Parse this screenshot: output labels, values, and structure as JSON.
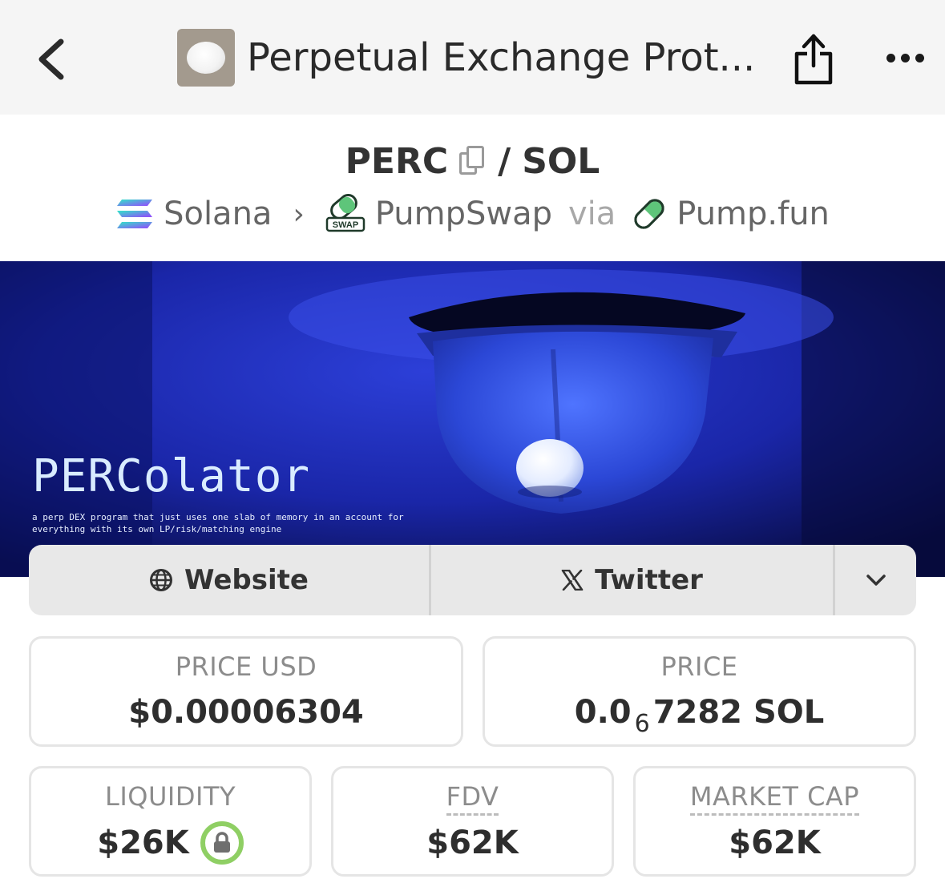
{
  "topbar": {
    "title": "Perpetual Exchange Prot..."
  },
  "pair": {
    "base": "PERC",
    "separator": "/",
    "quote": "SOL"
  },
  "breadcrumb": {
    "chain": "Solana",
    "dex": "PumpSwap",
    "dex_badge": "SWAP",
    "via_label": "via",
    "launchpad": "Pump.fun"
  },
  "banner": {
    "title": "PERColator",
    "subtitle": "a perp DEX program that just uses one slab of memory in an account for everything with its own LP/risk/matching engine"
  },
  "links": {
    "website_label": "Website",
    "twitter_label": "Twitter"
  },
  "stats": {
    "price_usd": {
      "label": "PRICE USD",
      "value": "$0.00006304"
    },
    "price": {
      "label": "PRICE",
      "value_prefix": "0.0",
      "value_zeros_count": "6",
      "value_suffix": "7282 SOL"
    },
    "liquidity": {
      "label": "LIQUIDITY",
      "value": "$26K"
    },
    "fdv": {
      "label": "FDV",
      "value": "$62K"
    },
    "market_cap": {
      "label": "MARKET CAP",
      "value": "$62K"
    }
  },
  "colors": {
    "topbar_bg": "#f5f5f5",
    "banner_bg": "#0e1570",
    "liquidity_lock_ring": "#8fcf64",
    "linkbar_bg": "#e8e8e8"
  },
  "icons": [
    "back-chevron-icon",
    "share-icon",
    "more-dots-icon",
    "copy-icon",
    "solana-icon",
    "pumpswap-icon",
    "pumpfun-pill-icon",
    "globe-icon",
    "x-logo-icon",
    "chevron-down-icon",
    "lock-icon"
  ]
}
